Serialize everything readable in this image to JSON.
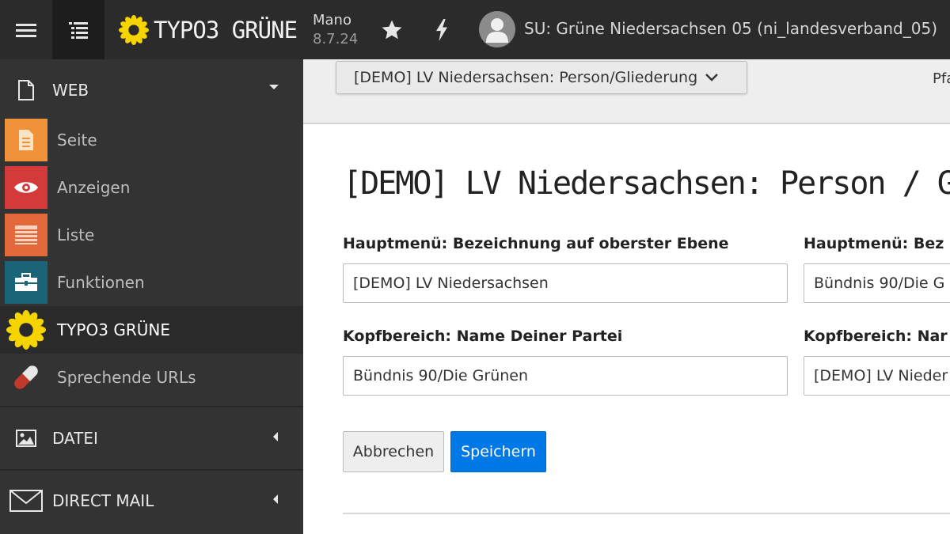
{
  "topbar": {
    "logo_text": "TYPO3 GRÜNE",
    "version_line1": "Mano",
    "version_line2": "8.7.24",
    "user_label": "SU: Grüne Niedersachsen 05 (ni_landesverband_05)",
    "icons": [
      "menu-icon",
      "page-tree-icon",
      "sunflower-logo",
      "star-icon",
      "bolt-icon",
      "user-avatar-icon"
    ]
  },
  "sidebar": {
    "groups": [
      {
        "label": "WEB",
        "icon": "document-icon",
        "expanded": true
      },
      {
        "label": "DATEI",
        "icon": "image-icon",
        "expanded": false
      },
      {
        "label": "DIRECT MAIL",
        "icon": "envelope-icon",
        "expanded": false
      }
    ],
    "items": [
      {
        "label": "Seite",
        "icon": "page-icon",
        "color": "#f0923a"
      },
      {
        "label": "Anzeigen",
        "icon": "eye-icon",
        "color": "#d43a3a"
      },
      {
        "label": "Liste",
        "icon": "list-icon",
        "color": "#e2693a"
      },
      {
        "label": "Funktionen",
        "icon": "toolbox-icon",
        "color": "#1a6478"
      },
      {
        "label": "TYPO3 GRÜNE",
        "icon": "sunflower-icon",
        "color": "#f5d400",
        "active": true
      },
      {
        "label": "Sprechende URLs",
        "icon": "pill-icon",
        "color": "#c0392b"
      }
    ]
  },
  "docheader": {
    "selected_form": "[DEMO] LV Niedersachsen: Person/Gliederung",
    "path_label": "Pfa"
  },
  "form": {
    "title": "[DEMO] LV Niedersachsen: Person / Glieder",
    "fields": [
      {
        "label": "Hauptmenü: Bezeichnung auf oberster Ebene",
        "value": "[DEMO] LV Niedersachsen"
      },
      {
        "label": "Hauptmenü: Bez",
        "value": "Bündnis 90/Die G"
      },
      {
        "label": "Kopfbereich: Name Deiner Partei",
        "value": "Bündnis 90/Die Grünen"
      },
      {
        "label": "Kopfbereich: Nar",
        "value": "[DEMO] LV Nieder"
      }
    ],
    "cancel_label": "Abbrechen",
    "save_label": "Speichern"
  },
  "colors": {
    "topbar": "#2b2b2b",
    "sidebar": "#333333",
    "accent_blue": "#0078e6",
    "sunflower_yellow": "#f5d400"
  }
}
